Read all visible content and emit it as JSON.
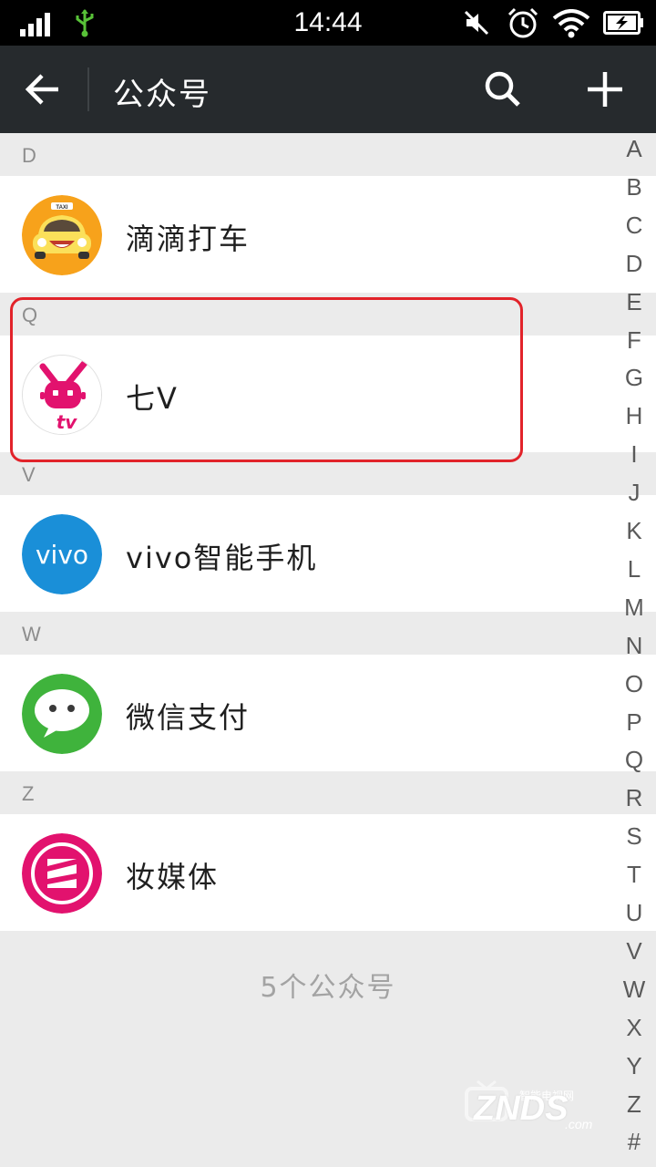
{
  "status_bar": {
    "time": "14:44",
    "icons": [
      "signal-icon",
      "usb-icon",
      "mute-icon",
      "alarm-icon",
      "wifi-icon",
      "battery-charging-icon"
    ]
  },
  "action_bar": {
    "title": "公众号",
    "back_icon": "arrow-left-icon",
    "search_icon": "search-icon",
    "add_icon": "plus-icon"
  },
  "sections": [
    {
      "letter": "D",
      "items": [
        {
          "name": "滴滴打车",
          "icon": "taxi-logo"
        }
      ]
    },
    {
      "letter": "Q",
      "items": [
        {
          "name": "七V",
          "icon": "tv-rabbit-logo"
        }
      ]
    },
    {
      "letter": "V",
      "items": [
        {
          "name": "vivo智能手机",
          "icon": "vivo-logo",
          "logo_text": "vivo"
        }
      ]
    },
    {
      "letter": "W",
      "items": [
        {
          "name": "微信支付",
          "icon": "wechat-logo"
        }
      ]
    },
    {
      "letter": "Z",
      "items": [
        {
          "name": "妆媒体",
          "icon": "magenta-circle-logo"
        }
      ]
    }
  ],
  "footer": {
    "count_text": "5个公众号"
  },
  "alphabet_index": [
    "A",
    "B",
    "C",
    "D",
    "E",
    "F",
    "G",
    "H",
    "I",
    "J",
    "K",
    "L",
    "M",
    "N",
    "O",
    "P",
    "Q",
    "R",
    "S",
    "T",
    "U",
    "V",
    "W",
    "X",
    "Y",
    "Z",
    "#"
  ],
  "watermark": {
    "text": "ZNDS",
    "suffix": ".com",
    "top_text": "智能电视网"
  },
  "colors": {
    "action_bar": "#262a2d",
    "background": "#ebebeb",
    "highlight": "#e2232a",
    "wechat_green": "#3fb33c",
    "vivo_blue": "#1a8fd8",
    "zhuang_magenta": "#e2126e"
  }
}
